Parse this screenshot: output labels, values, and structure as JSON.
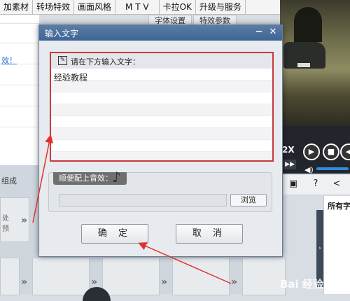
{
  "top_tabs": [
    "加素材",
    "转场特效",
    "画面风格",
    "M T V",
    "卡拉OK",
    "升级与服务"
  ],
  "mid_tabs": [
    "字体设置",
    "特效参数"
  ],
  "left_panel": {
    "link_text": "效！"
  },
  "bottom_area": {
    "group_label": "组成",
    "slot_label": "处\n预"
  },
  "dialog": {
    "title": "输入文字",
    "minimize_icon": "minimize-icon",
    "close_icon": "close-icon",
    "text_panel_label": "请在下方输入文字：",
    "text_value": "经验教程",
    "sound_label": "顺便配上音效：",
    "browse_label": "浏览",
    "ok_label": "确 定",
    "cancel_label": "取 消"
  },
  "player": {
    "speed_label": "2X"
  },
  "right_list": {
    "header": "所有字"
  },
  "watermark": "Bai 经验",
  "colors": {
    "title_bar": "#4a719e",
    "highlight": "#c9393b",
    "accent": "#2f8bdd"
  }
}
